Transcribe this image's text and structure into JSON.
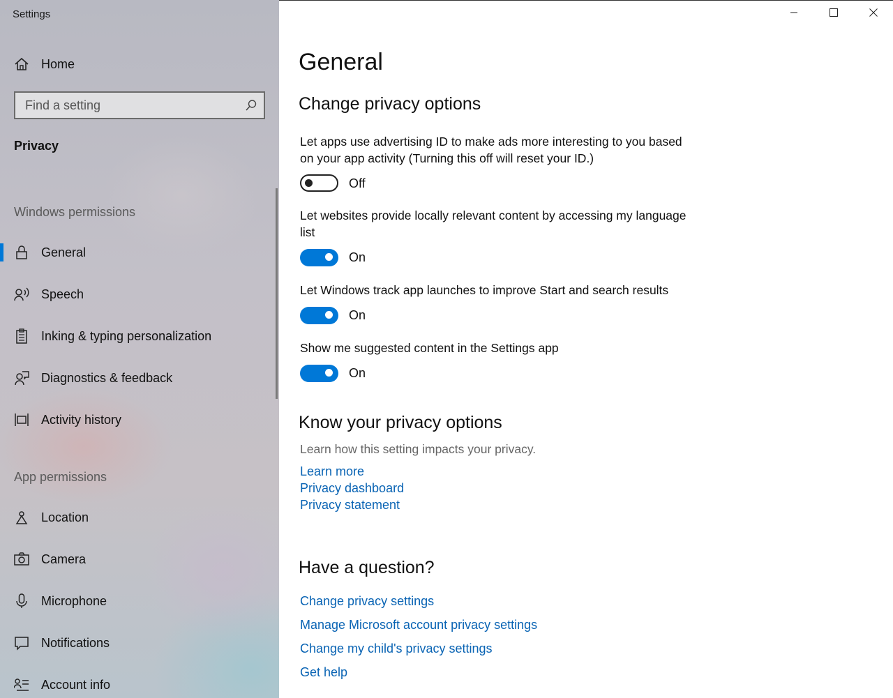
{
  "window": {
    "title": "Settings",
    "minimize_icon": "minimize-icon",
    "maximize_icon": "maximize-icon",
    "close_icon": "close-icon"
  },
  "sidebar": {
    "home_label": "Home",
    "search": {
      "placeholder": "Find a setting",
      "icon": "search-icon"
    },
    "category": "Privacy",
    "windows_permissions_header": "Windows permissions",
    "windows_permissions": [
      {
        "label": "General",
        "icon": "lock-icon",
        "active": true
      },
      {
        "label": "Speech",
        "icon": "speech-icon"
      },
      {
        "label": "Inking & typing personalization",
        "icon": "clipboard-icon"
      },
      {
        "label": "Diagnostics & feedback",
        "icon": "diagnostics-icon"
      },
      {
        "label": "Activity history",
        "icon": "timeline-icon"
      }
    ],
    "app_permissions_header": "App permissions",
    "app_permissions": [
      {
        "label": "Location",
        "icon": "location-icon"
      },
      {
        "label": "Camera",
        "icon": "camera-icon"
      },
      {
        "label": "Microphone",
        "icon": "microphone-icon"
      },
      {
        "label": "Notifications",
        "icon": "notifications-icon"
      },
      {
        "label": "Account info",
        "icon": "account-info-icon"
      }
    ]
  },
  "main": {
    "page_title": "General",
    "change_privacy_heading": "Change privacy options",
    "settings": [
      {
        "description": "Let apps use advertising ID to make ads more interesting to you based on your app activity (Turning this off will reset your ID.)",
        "state": "Off",
        "on": false
      },
      {
        "description": "Let websites provide locally relevant content by accessing my language list",
        "state": "On",
        "on": true
      },
      {
        "description": "Let Windows track app launches to improve Start and search results",
        "state": "On",
        "on": true
      },
      {
        "description": "Show me suggested content in the Settings app",
        "state": "On",
        "on": true
      }
    ],
    "know_heading": "Know your privacy options",
    "know_desc": "Learn how this setting impacts your privacy.",
    "know_links": [
      "Learn more",
      "Privacy dashboard",
      "Privacy statement"
    ],
    "question_heading": "Have a question?",
    "question_links": [
      "Change privacy settings",
      "Manage Microsoft account privacy settings",
      "Change my child's privacy settings",
      "Get help"
    ]
  },
  "colors": {
    "accent": "#0078d7",
    "link": "#0a64b4"
  }
}
